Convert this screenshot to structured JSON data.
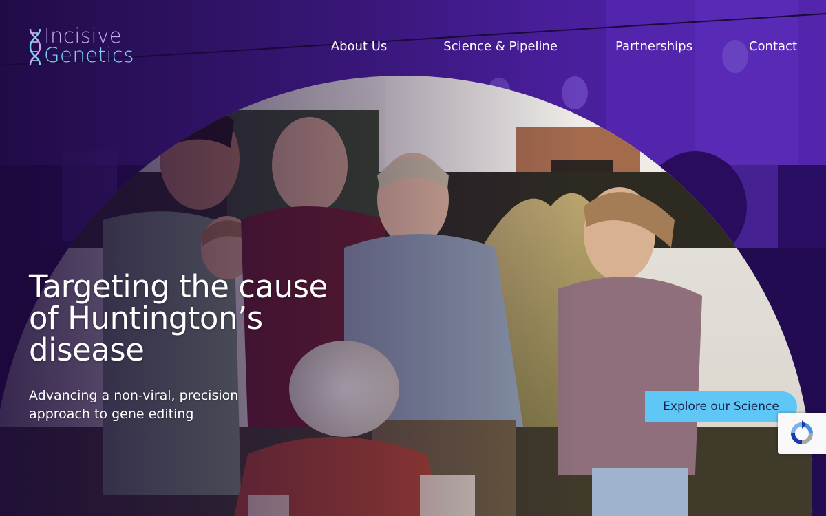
{
  "brand": {
    "line1": "Incisive",
    "line2": "Genetics",
    "icon": "dna-helix-icon"
  },
  "nav": {
    "items": [
      "About Us",
      "Science & Pipeline",
      "Partnerships",
      "Contact"
    ]
  },
  "hero": {
    "title": "Targeting the cause of Huntington’s disease",
    "subtitle": "Advancing a non-viral, precision approach to gene editing",
    "cta": "Explore our Science"
  },
  "recaptcha": {
    "icon": "recaptcha-icon"
  },
  "colors": {
    "brand_purple": "#4a1a9e",
    "brand_lilac": "#c9a9f2",
    "brand_cyan": "#5ec7f6",
    "cta_text": "#1d1e4a"
  }
}
